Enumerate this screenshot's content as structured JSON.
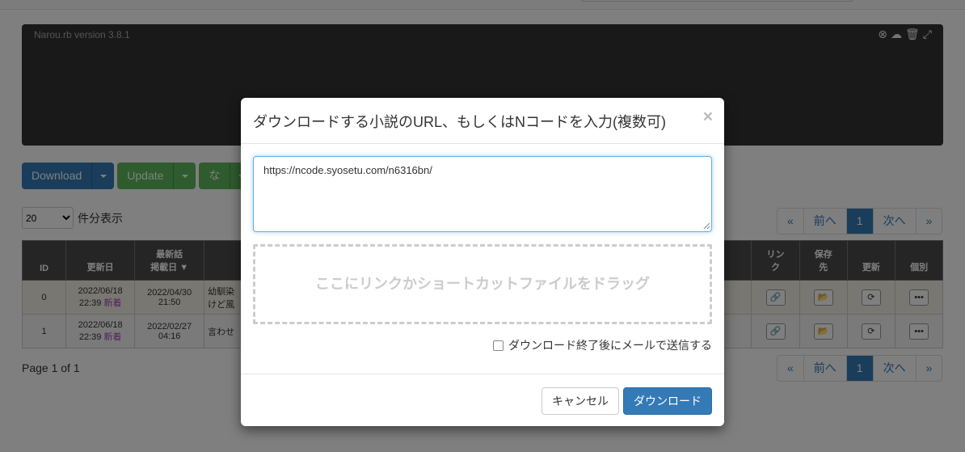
{
  "console": {
    "version_text": "Narou.rb version 3.8.1",
    "controls": [
      "close-circle-icon",
      "cloud-download-icon",
      "trash-icon",
      "expand-icon"
    ]
  },
  "toolbar": {
    "download_label": "Download",
    "update_label": "Update",
    "third_label": "な"
  },
  "list": {
    "per_page_value": "20",
    "per_page_suffix": "件分表示",
    "page_info": "Page 1 of 1"
  },
  "pager": {
    "first": "«",
    "prev": "前へ",
    "current": "1",
    "next": "次へ",
    "last": "»"
  },
  "table": {
    "headers": {
      "id": "ID",
      "updated": "更新日",
      "latest_line1": "最新話",
      "latest_line2": "掲載日",
      "link_line1": "リン",
      "link_line2": "ク",
      "save_line1": "保存",
      "save_line2": "先",
      "update": "更新",
      "individual": "個別"
    },
    "rows": [
      {
        "id": "0",
        "updated_date": "2022/06/18",
        "updated_time": "22:39",
        "new_badge": "新着",
        "latest_date": "2022/04/30",
        "latest_time": "21:50",
        "title_line1": "幼馴染",
        "title_line2": "けど風"
      },
      {
        "id": "1",
        "updated_date": "2022/06/18",
        "updated_time": "22:39",
        "new_badge": "新着",
        "latest_date": "2022/02/27",
        "latest_time": "04:16",
        "title_line1": "言わせ",
        "title_line2": ""
      }
    ]
  },
  "modal": {
    "title": "ダウンロードする小説のURL、もしくはNコードを入力(複数可)",
    "close_symbol": "×",
    "url_value": "https://ncode.syosetu.com/n6316bn/",
    "dropzone_text": "ここにリンクかショートカットファイルをドラッグ",
    "mail_option": "ダウンロード終了後にメールで送信する",
    "cancel_label": "キャンセル",
    "download_label": "ダウンロード"
  },
  "colors": {
    "primary": "#337ab7",
    "success": "#5cb85c",
    "new_badge": "#a04ab8",
    "console_bg": "#333333"
  }
}
